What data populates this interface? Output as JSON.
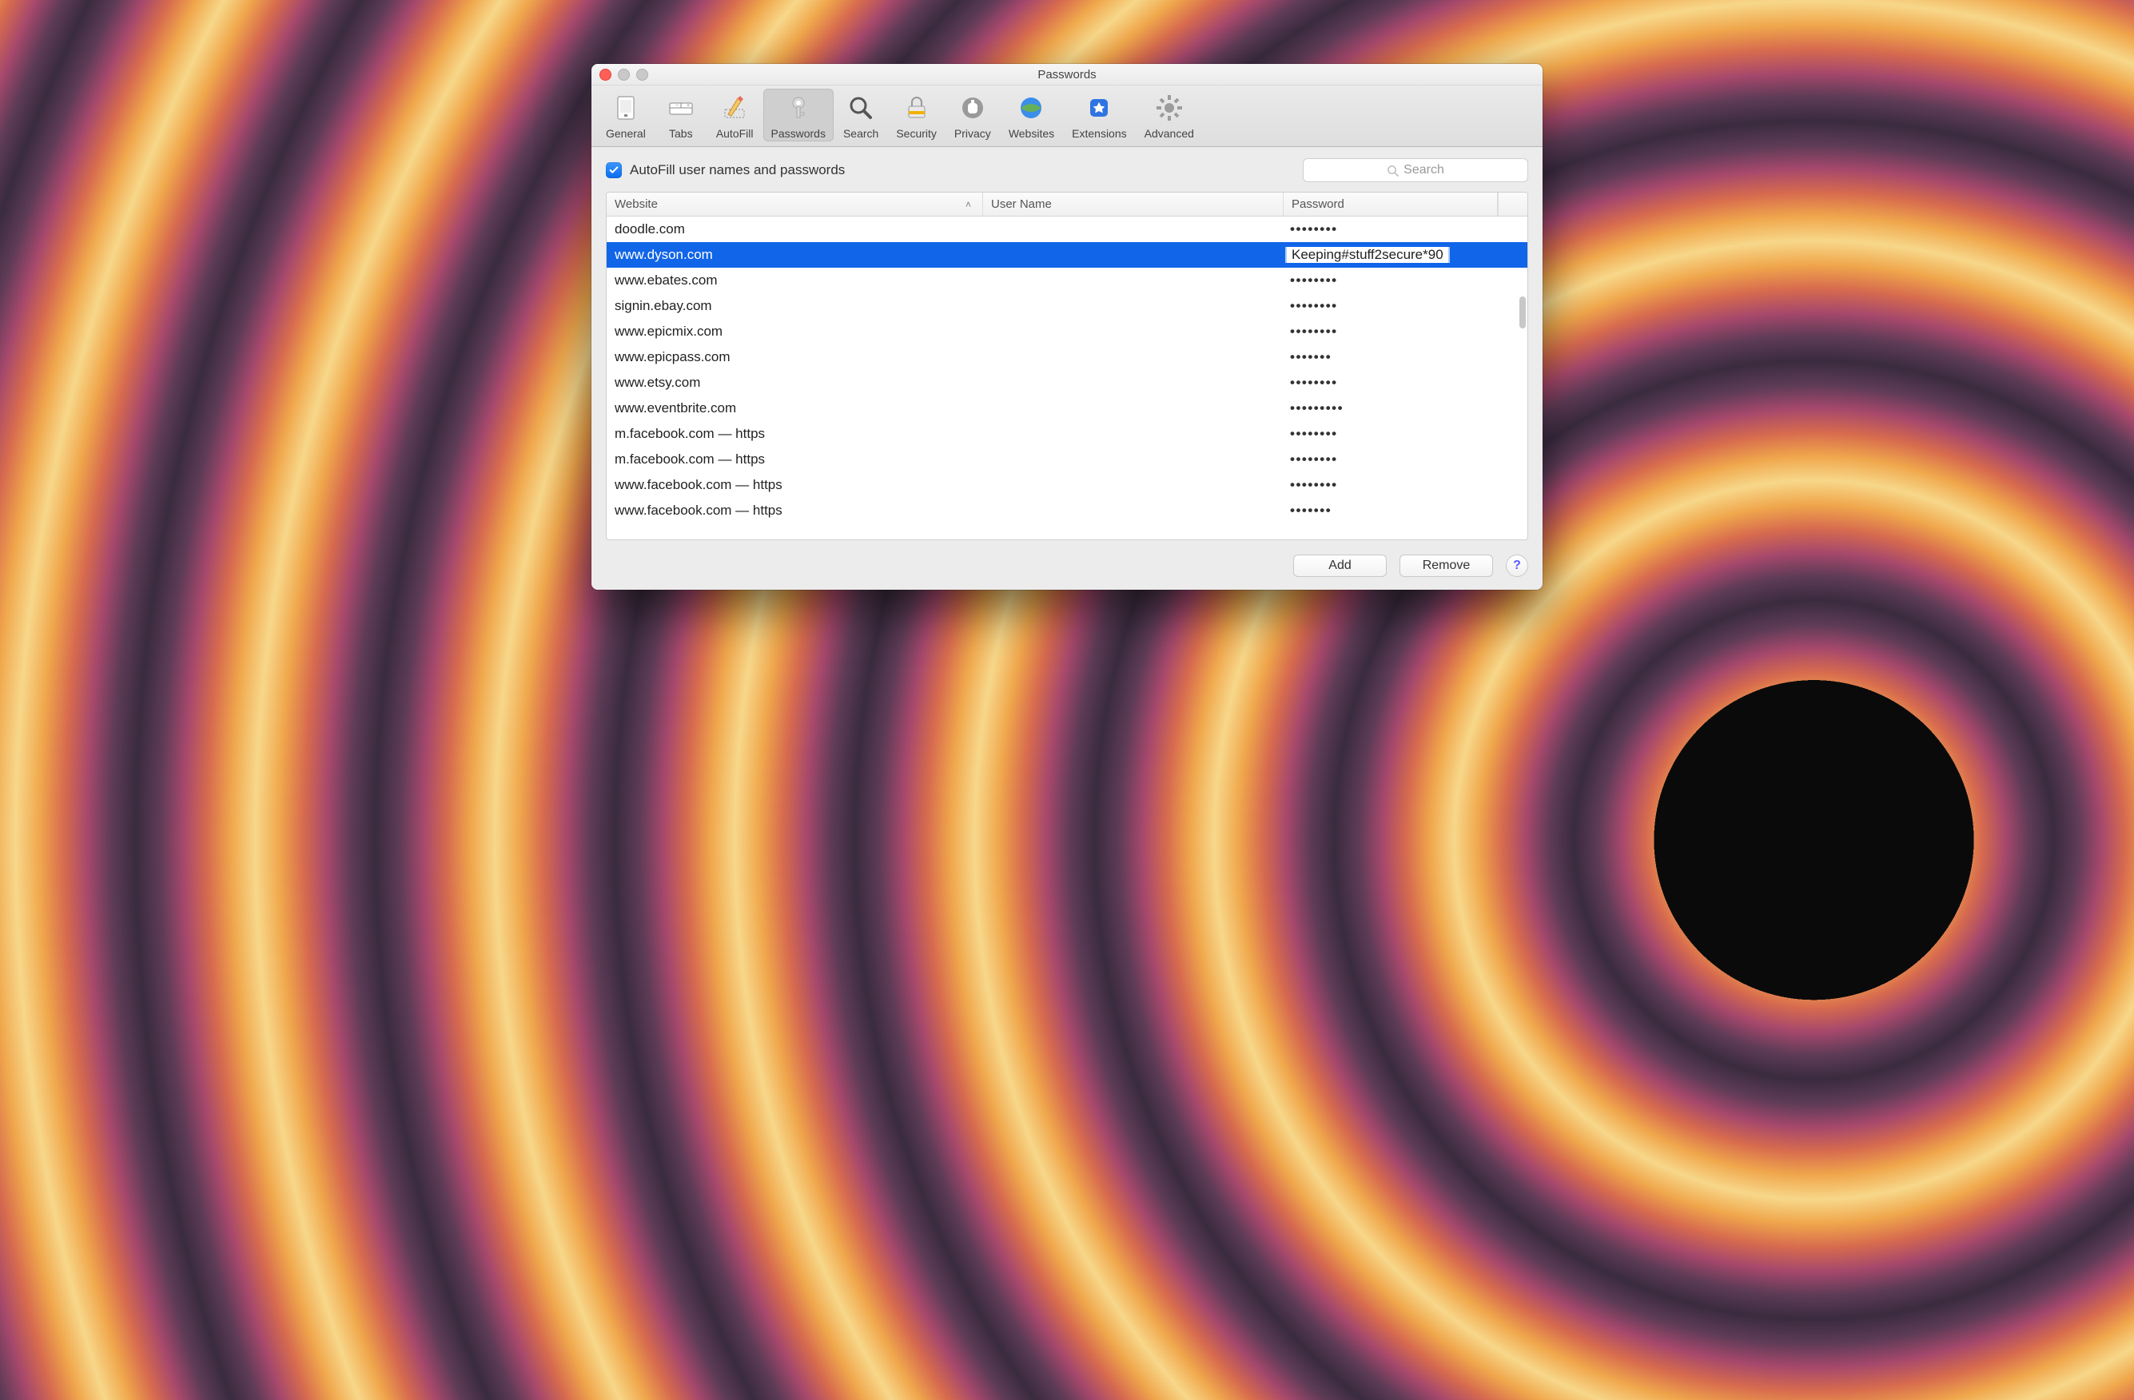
{
  "window": {
    "title": "Passwords"
  },
  "toolbar": {
    "items": [
      {
        "id": "general",
        "label": "General"
      },
      {
        "id": "tabs",
        "label": "Tabs"
      },
      {
        "id": "autofill",
        "label": "AutoFill"
      },
      {
        "id": "passwords",
        "label": "Passwords"
      },
      {
        "id": "search",
        "label": "Search"
      },
      {
        "id": "security",
        "label": "Security"
      },
      {
        "id": "privacy",
        "label": "Privacy"
      },
      {
        "id": "websites",
        "label": "Websites"
      },
      {
        "id": "extensions",
        "label": "Extensions"
      },
      {
        "id": "advanced",
        "label": "Advanced"
      }
    ],
    "selected": "passwords"
  },
  "autofill_checkbox_label": "AutoFill user names and passwords",
  "search": {
    "placeholder": "Search"
  },
  "columns": {
    "website": "Website",
    "username": "User Name",
    "password": "Password"
  },
  "rows": [
    {
      "website": "doodle.com",
      "username": "",
      "password": "••••••••"
    },
    {
      "website": "www.dyson.com",
      "username": "",
      "password": "Keeping#stuff2secure*90",
      "selected": true,
      "editing": true
    },
    {
      "website": "www.ebates.com",
      "username": "",
      "password": "••••••••"
    },
    {
      "website": "signin.ebay.com",
      "username": "",
      "password": "••••••••"
    },
    {
      "website": "www.epicmix.com",
      "username": "",
      "password": "••••••••"
    },
    {
      "website": "www.epicpass.com",
      "username": "",
      "password": "•••••••"
    },
    {
      "website": "www.etsy.com",
      "username": "",
      "password": "••••••••"
    },
    {
      "website": "www.eventbrite.com",
      "username": "",
      "password": "•••••••••"
    },
    {
      "website": "m.facebook.com — https",
      "username": "",
      "password": "••••••••"
    },
    {
      "website": "m.facebook.com — https",
      "username": "",
      "password": "••••••••"
    },
    {
      "website": "www.facebook.com — https",
      "username": "",
      "password": "••••••••"
    },
    {
      "website": "www.facebook.com — https",
      "username": "",
      "password": "•••••••"
    }
  ],
  "buttons": {
    "add": "Add",
    "remove": "Remove",
    "help": "?"
  }
}
